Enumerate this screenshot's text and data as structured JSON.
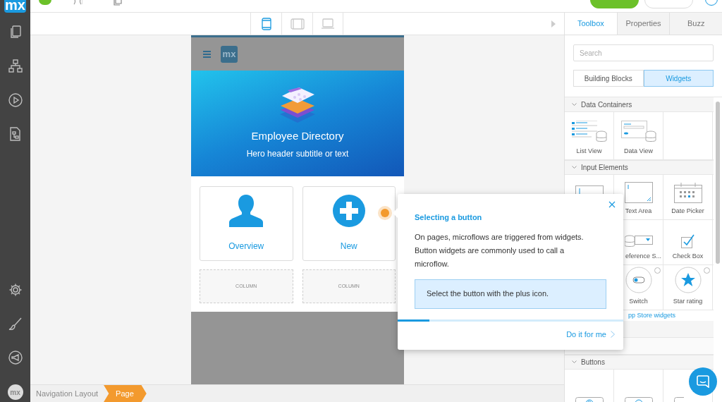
{
  "app_logo": "mx",
  "top_bar": {
    "buttons": [
      {
        "kind": "primary"
      },
      {
        "kind": "outline"
      }
    ]
  },
  "sidebar": {
    "user": "mx"
  },
  "devices": [
    {
      "kind": "phone",
      "selected": true
    },
    {
      "kind": "tablet",
      "selected": false
    },
    {
      "kind": "desktop",
      "selected": false
    }
  ],
  "phone_page": {
    "logo": "mx",
    "hero_title": "Employee Directory",
    "hero_subtitle": "Hero header subtitle or text",
    "cards": [
      {
        "kind": "person",
        "label": "Overview"
      },
      {
        "kind": "plus",
        "label": "New"
      }
    ],
    "placeholders": [
      "COLUMN",
      "COLUMN"
    ]
  },
  "breadcrumb": [
    {
      "label": "Navigation Layout",
      "selected": false
    },
    {
      "label": "Page",
      "selected": true
    }
  ],
  "panel": {
    "tabs": [
      {
        "label": "Toolbox",
        "selected": true
      },
      {
        "label": "Properties",
        "selected": false
      },
      {
        "label": "Buzz",
        "selected": false
      }
    ],
    "search": {
      "placeholder": "Search"
    },
    "modes": [
      {
        "label": "Building Blocks",
        "selected": false
      },
      {
        "label": "Widgets",
        "selected": true
      }
    ],
    "sections": [
      {
        "title": "Data Containers",
        "rows": [
          [
            {
              "kind": "list-view",
              "label": "List View"
            },
            {
              "kind": "data-view",
              "label": "Data View"
            }
          ]
        ]
      },
      {
        "title": "Input Elements",
        "rows": [
          [
            {
              "kind": "text-box"
            },
            {
              "kind": "text-area",
              "label": "Text Area"
            },
            {
              "kind": "date-picker",
              "label": "Date Picker"
            }
          ],
          [
            "",
            {
              "kind": "reference-selector",
              "label": "eference S..."
            },
            {
              "kind": "check-box",
              "label": "Check Box"
            }
          ],
          [
            "",
            {
              "kind": "switch",
              "label": "Switch",
              "info": true
            },
            {
              "kind": "star-rating",
              "label": "Star rating",
              "info": true
            }
          ]
        ],
        "link": "pp Store widgets"
      },
      {
        "kind": "collapsed"
      },
      {
        "kind": "collapsed"
      },
      {
        "title": "Buttons",
        "rows": [
          [
            {
              "kind": "button-doc"
            },
            {
              "kind": "button-play"
            },
            {
              "kind": "button-plus"
            }
          ]
        ]
      }
    ]
  },
  "popover": {
    "title": "Selecting a button",
    "body": "On pages, microflows are triggered from widgets. Button widgets are commonly used to call a microflow.",
    "hint": "Select the button with the plus icon.",
    "progress": {
      "level": 0.14
    },
    "action": "Do it for me"
  }
}
